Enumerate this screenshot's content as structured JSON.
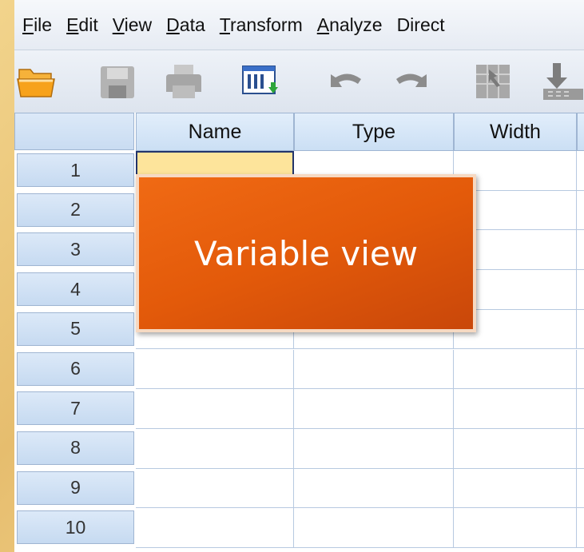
{
  "menu": {
    "items": [
      {
        "mnemonic": "F",
        "rest": "ile"
      },
      {
        "mnemonic": "E",
        "rest": "dit"
      },
      {
        "mnemonic": "V",
        "rest": "iew"
      },
      {
        "mnemonic": "D",
        "rest": "ata"
      },
      {
        "mnemonic": "T",
        "rest": "ransform"
      },
      {
        "pre": "",
        "mnemonic": "A",
        "rest": "nalyze"
      },
      {
        "mnemonic": "",
        "rest": "Direct"
      }
    ]
  },
  "toolbar": {
    "icons": [
      "open-folder-icon",
      "save-icon",
      "print-icon",
      "dialog-recall-icon",
      "undo-icon",
      "redo-icon",
      "goto-case-icon",
      "import-data-icon"
    ]
  },
  "grid": {
    "columns": [
      "Name",
      "Type",
      "Width"
    ],
    "rows": [
      "1",
      "2",
      "3",
      "4",
      "5",
      "6",
      "7",
      "8",
      "9",
      "10"
    ],
    "selected_cell": {
      "row": 0,
      "col": 0
    }
  },
  "overlay": {
    "label": "Variable view"
  },
  "colors": {
    "overlay_orange": "#e35a0a",
    "selected_cell": "#fde49b",
    "header_blue": "#cbdff4"
  }
}
